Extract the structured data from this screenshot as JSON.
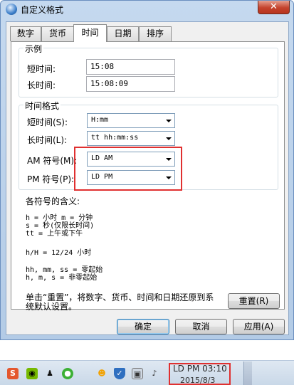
{
  "window": {
    "title": "自定义格式",
    "close_label": "✕"
  },
  "tabs": [
    {
      "label": "数字",
      "active": false
    },
    {
      "label": "货币",
      "active": false
    },
    {
      "label": "时间",
      "active": true
    },
    {
      "label": "日期",
      "active": false
    },
    {
      "label": "排序",
      "active": false
    }
  ],
  "example": {
    "title": "示例",
    "short_label": "短时间:",
    "short_value": "15:08",
    "long_label": "长时间:",
    "long_value": "15:08:09"
  },
  "formats": {
    "title": "时间格式",
    "short_label": "短时间(S):",
    "short_value": "H:mm",
    "long_label": "长时间(L):",
    "long_value": "tt hh:mm:ss",
    "am_label": "AM 符号(M):",
    "am_value": "LD AM",
    "pm_label": "PM 符号(P):",
    "pm_value": "LD PM"
  },
  "legend": {
    "title": "各符号的含义:",
    "line1": "h = 小时   m = 分钟",
    "line2": "s = 秒(仅限长时间)",
    "line3": "tt = 上午或下午",
    "line4": "h/H = 12/24 小时",
    "line5": "hh, mm, ss = 零起始",
    "line6": "h, m, s = 非零起始"
  },
  "reset": {
    "text_line1": "单击“重置”，将数字、货币、时间和日期还原到系",
    "text_line2": "统默认设置。",
    "button": "重置(R)"
  },
  "buttons": {
    "ok": "确定",
    "cancel": "取消",
    "apply": "应用(A)"
  },
  "taskbar": {
    "clock_time": "LD PM 03:10",
    "clock_date": "2015/8/3",
    "icons": [
      "sogou-icon",
      "nvidia-icon",
      "penguin-icon",
      "wechat-icon",
      "qq-icon",
      "shield-icon",
      "network-icon",
      "volume-muted-icon"
    ]
  },
  "colors": {
    "highlight": "#e03030",
    "titlebar": "#c5d9ef",
    "close": "#c4432d"
  }
}
